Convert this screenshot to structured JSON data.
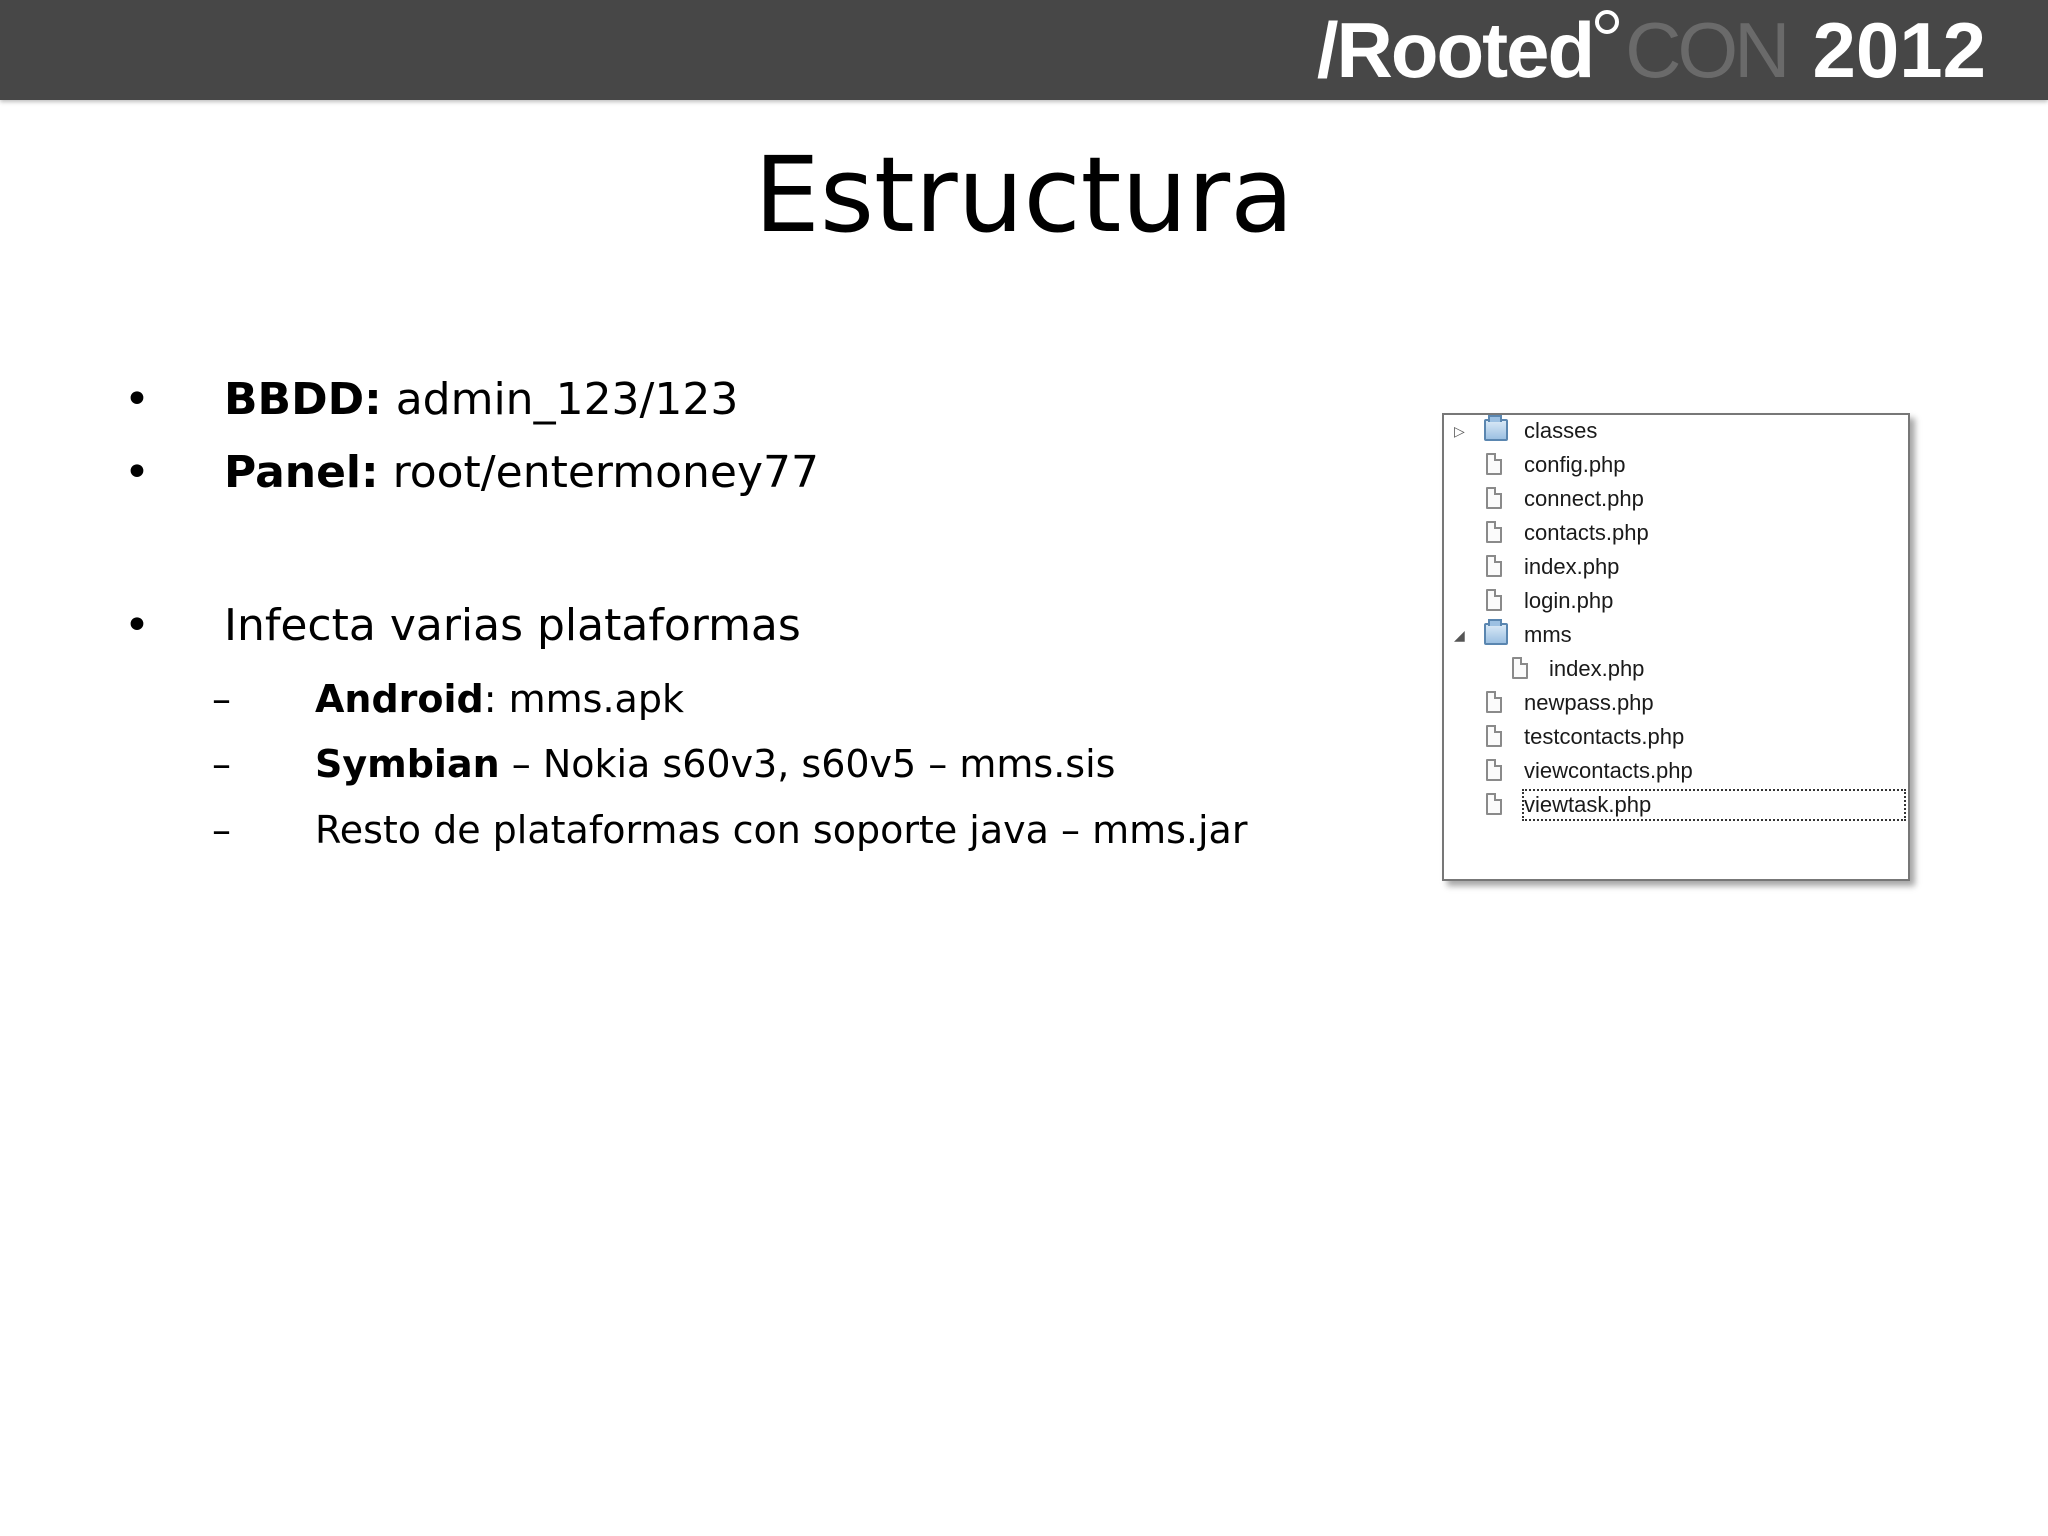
{
  "header": {
    "logo_part1": "/Rooted",
    "logo_part2": "CON",
    "logo_part3": "2012"
  },
  "slide": {
    "title": "Estructura",
    "bullet_marker": "•",
    "dash_marker": "–",
    "bullets": [
      {
        "bold": "BBDD:",
        "text": " admin_123/123"
      },
      {
        "bold": "Panel:",
        "text": " root/entermoney77"
      },
      {
        "bold": "",
        "text": "Infecta varias plataformas"
      }
    ],
    "sub_bullets": [
      {
        "bold": "Android",
        "text": ": mms.apk"
      },
      {
        "bold": "Symbian",
        "text": " – Nokia s60v3, s60v5 – mms.sis"
      },
      {
        "bold": "",
        "text": "Resto de plataformas con soporte java – mms.jar"
      }
    ]
  },
  "file_tree": {
    "items": [
      {
        "name": "classes",
        "kind": "folder",
        "expanded": false,
        "depth": 0,
        "toggle": "▷"
      },
      {
        "name": "config.php",
        "kind": "file",
        "depth": 0
      },
      {
        "name": "connect.php",
        "kind": "file",
        "depth": 0
      },
      {
        "name": "contacts.php",
        "kind": "file",
        "depth": 0
      },
      {
        "name": "index.php",
        "kind": "file",
        "depth": 0
      },
      {
        "name": "login.php",
        "kind": "file",
        "depth": 0
      },
      {
        "name": "mms",
        "kind": "folder",
        "expanded": true,
        "depth": 0,
        "toggle": "◢"
      },
      {
        "name": "index.php",
        "kind": "file",
        "depth": 1
      },
      {
        "name": "newpass.php",
        "kind": "file",
        "depth": 0
      },
      {
        "name": "testcontacts.php",
        "kind": "file",
        "depth": 0
      },
      {
        "name": "viewcontacts.php",
        "kind": "file",
        "depth": 0
      },
      {
        "name": "viewtask.php",
        "kind": "file",
        "depth": 0,
        "selected": true
      }
    ]
  },
  "colors": {
    "header_bg": "#474747",
    "logo_grey": "#6a6a6a",
    "folder_blue": "#9cc0e2"
  }
}
